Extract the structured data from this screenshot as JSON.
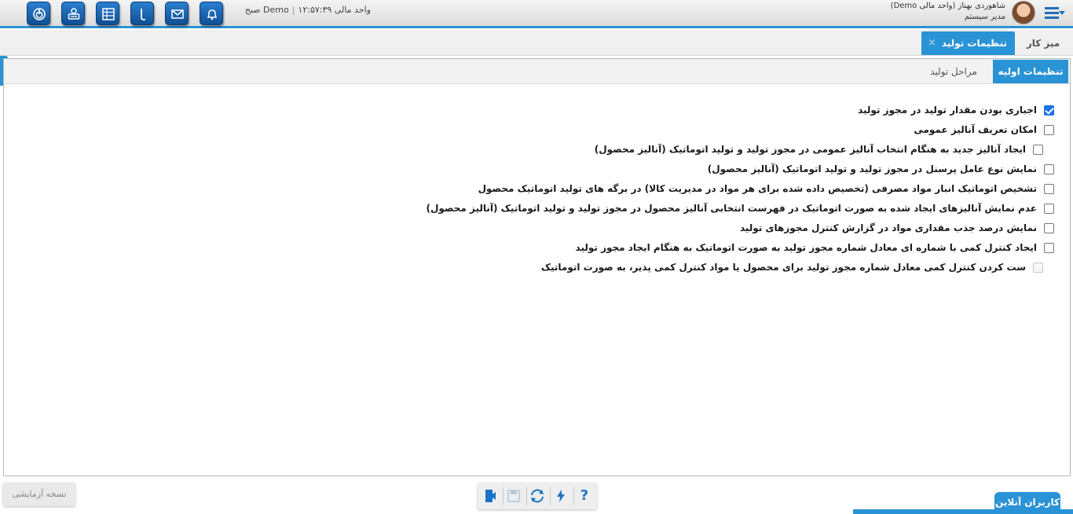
{
  "header": {
    "user_name": "شاهوردی بهناز (واحد مالی Demo)",
    "user_role": "مدیر سیستم",
    "unit": "واحد مالی Demo",
    "time": "۱۲:۵۷:۳۹ صبح",
    "icons": [
      "power-icon",
      "user-settings-icon",
      "sheet-icon",
      "tool-icon",
      "mail-icon",
      "bell-icon"
    ]
  },
  "tabs": {
    "desk_label": "میز کار",
    "active_label": "تنظیمات تولید",
    "close_glyph": "×"
  },
  "subtabs": {
    "initial_label": "تنظیمات اولیه",
    "stages_label": "مراحل تولید"
  },
  "options": [
    {
      "label": "اجباری بودن مقدار تولید در مجوز تولید",
      "checked": true,
      "indent": false,
      "disabled": false
    },
    {
      "label": "امکان تعریف آنالیز عمومی",
      "checked": false,
      "indent": false,
      "disabled": false
    },
    {
      "label": "ایجاد آنالیز جدید به هنگام انتخاب آنالیز عمومی در مجوز تولید و تولید اتوماتیک (آنالیز محصول)",
      "checked": false,
      "indent": true,
      "disabled": false
    },
    {
      "label": "نمایش نوع عامل پرسنل در مجوز تولید و تولید اتوماتیک (آنالیز محصول)",
      "checked": false,
      "indent": false,
      "disabled": false
    },
    {
      "label": "تشخیص اتوماتیک انبار مواد مصرفی (تخصیص داده شده برای هر مواد در مدیریت کالا) در برگه های تولید اتوماتیک محصول",
      "checked": false,
      "indent": false,
      "disabled": false
    },
    {
      "label": "عدم نمایش آنالیزهای ایجاد شده به صورت اتوماتیک در فهرست انتخابی آنالیز محصول در مجوز تولید و تولید اتوماتیک (آنالیز محصول)",
      "checked": false,
      "indent": false,
      "disabled": false
    },
    {
      "label": "نمایش درصد جذب مقداری مواد در گزارش کنترل مجوزهای تولید",
      "checked": false,
      "indent": false,
      "disabled": false
    },
    {
      "label": "ایجاد کنترل کمی با شماره ای معادل شماره مجوز تولید به صورت اتوماتیک به هنگام ایجاد مجوز تولید",
      "checked": false,
      "indent": false,
      "disabled": false
    },
    {
      "label": "ست کردن کنترل کمی معادل شماره مجوز تولید برای محصول یا مواد کنترل کمی پذیر، به صورت اتوماتیک",
      "checked": false,
      "indent": true,
      "disabled": true
    }
  ],
  "footer": {
    "trial_label": "نسخه آزمایشی",
    "online_users_label": "کاربران آنلاین",
    "help_glyph": "?",
    "action_icons": [
      "exit-icon",
      "save-icon",
      "refresh-icon",
      "flash-icon",
      "help-icon"
    ]
  },
  "colors": {
    "accent": "#2a93d5",
    "toolbar_button": "#1a5fa8"
  }
}
